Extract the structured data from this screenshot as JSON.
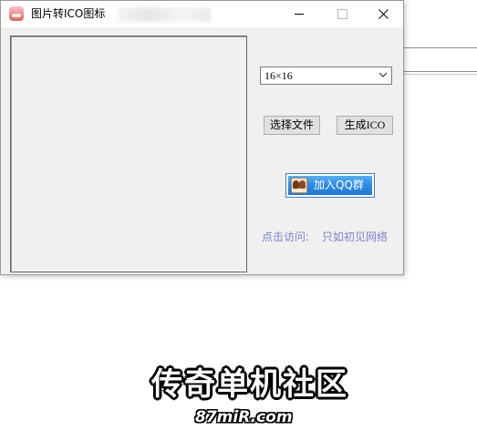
{
  "window": {
    "title": "图片转ICO图标",
    "controls": {
      "minimize": "minimize-icon",
      "maximize": "maximize-icon",
      "close": "close-icon"
    }
  },
  "size_select": {
    "value": "16×16",
    "icon": "chevron-down-icon"
  },
  "buttons": {
    "choose_file": "选择文件",
    "generate_ico": "生成ICO"
  },
  "qq_button": {
    "label": "加入QQ群",
    "icon": "qq-avatar-icon"
  },
  "visit": {
    "label": "点击访问:",
    "link": "只如初见网络"
  },
  "watermark": {
    "title": "传奇单机社区",
    "url": "87miR.com"
  },
  "colors": {
    "link": "#7b82c9",
    "qq_button": "#2d8ae0"
  }
}
